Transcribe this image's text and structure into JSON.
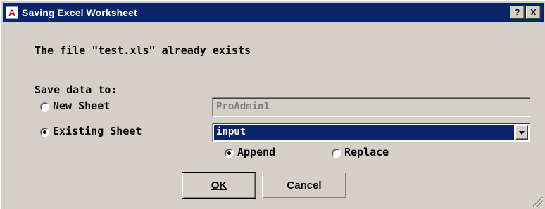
{
  "window": {
    "title": "Saving Excel Worksheet",
    "app_icon_glyph": "A"
  },
  "titlebar_buttons": {
    "help": "?",
    "close": "X"
  },
  "message": "The file \"test.xls\" already exists",
  "save_group": {
    "label": "Save data to:",
    "new_sheet": {
      "label": "New Sheet",
      "selected": false,
      "value": "ProAdmin1"
    },
    "existing_sheet": {
      "label": "Existing Sheet",
      "selected": true,
      "value": "input"
    }
  },
  "mode": {
    "append": {
      "label": "Append",
      "selected": true
    },
    "replace": {
      "label": "Replace",
      "selected": false
    }
  },
  "buttons": {
    "ok": "OK",
    "cancel": "Cancel"
  },
  "colors": {
    "titlebar": "#0a246a",
    "face": "#d4d0c8",
    "selection": "#0a246a"
  }
}
